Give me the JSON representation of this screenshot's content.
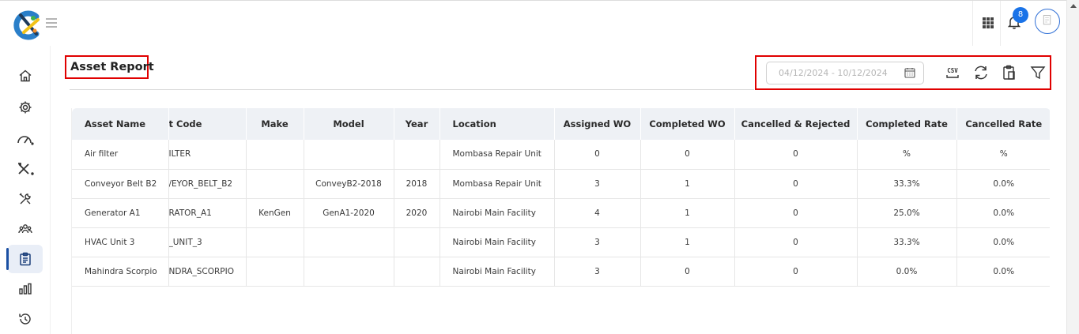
{
  "header": {
    "notification_count": "8"
  },
  "sidebar": {
    "items": [
      {
        "name": "home-icon"
      },
      {
        "name": "gear-icon"
      },
      {
        "name": "speedometer-icon"
      },
      {
        "name": "tools-icon"
      },
      {
        "name": "wrench-screwdriver-icon"
      },
      {
        "name": "team-icon"
      },
      {
        "name": "clipboard-icon",
        "active": true
      },
      {
        "name": "bar-chart-icon"
      },
      {
        "name": "history-icon"
      }
    ]
  },
  "page": {
    "title": "Asset Report"
  },
  "toolbar": {
    "date_range": "04/12/2024 - 10/12/2024",
    "csv_label": "CSV"
  },
  "table": {
    "headers": [
      "Asset Name",
      "t Code",
      "Make",
      "Model",
      "Year",
      "Location",
      "Assigned WO",
      "Completed WO",
      "Cancelled & Rejected",
      "Completed Rate",
      "Cancelled Rate"
    ],
    "rows": [
      [
        "Air filter",
        "ILTER",
        "",
        "",
        "",
        "Mombasa Repair Unit",
        "0",
        "0",
        "0",
        "%",
        "%"
      ],
      [
        "Conveyor Belt B2",
        "/EYOR_BELT_B2",
        "",
        "ConveyB2-2018",
        "2018",
        "Mombasa Repair Unit",
        "3",
        "1",
        "0",
        "33.3%",
        "0.0%"
      ],
      [
        "Generator A1",
        "RATOR_A1",
        "KenGen",
        "GenA1-2020",
        "2020",
        "Nairobi Main Facility",
        "4",
        "1",
        "0",
        "25.0%",
        "0.0%"
      ],
      [
        "HVAC Unit 3",
        "_UNIT_3",
        "",
        "",
        "",
        "Nairobi Main Facility",
        "3",
        "1",
        "0",
        "33.3%",
        "0.0%"
      ],
      [
        "Mahindra Scorpio",
        "NDRA_SCORPIO",
        "",
        "",
        "",
        "Nairobi Main Facility",
        "3",
        "0",
        "0",
        "0.0%",
        "0.0%"
      ]
    ]
  },
  "colors": {
    "accent": "#1a73e8",
    "highlight_border": "#e00000",
    "header_bg": "#eef1f5"
  }
}
